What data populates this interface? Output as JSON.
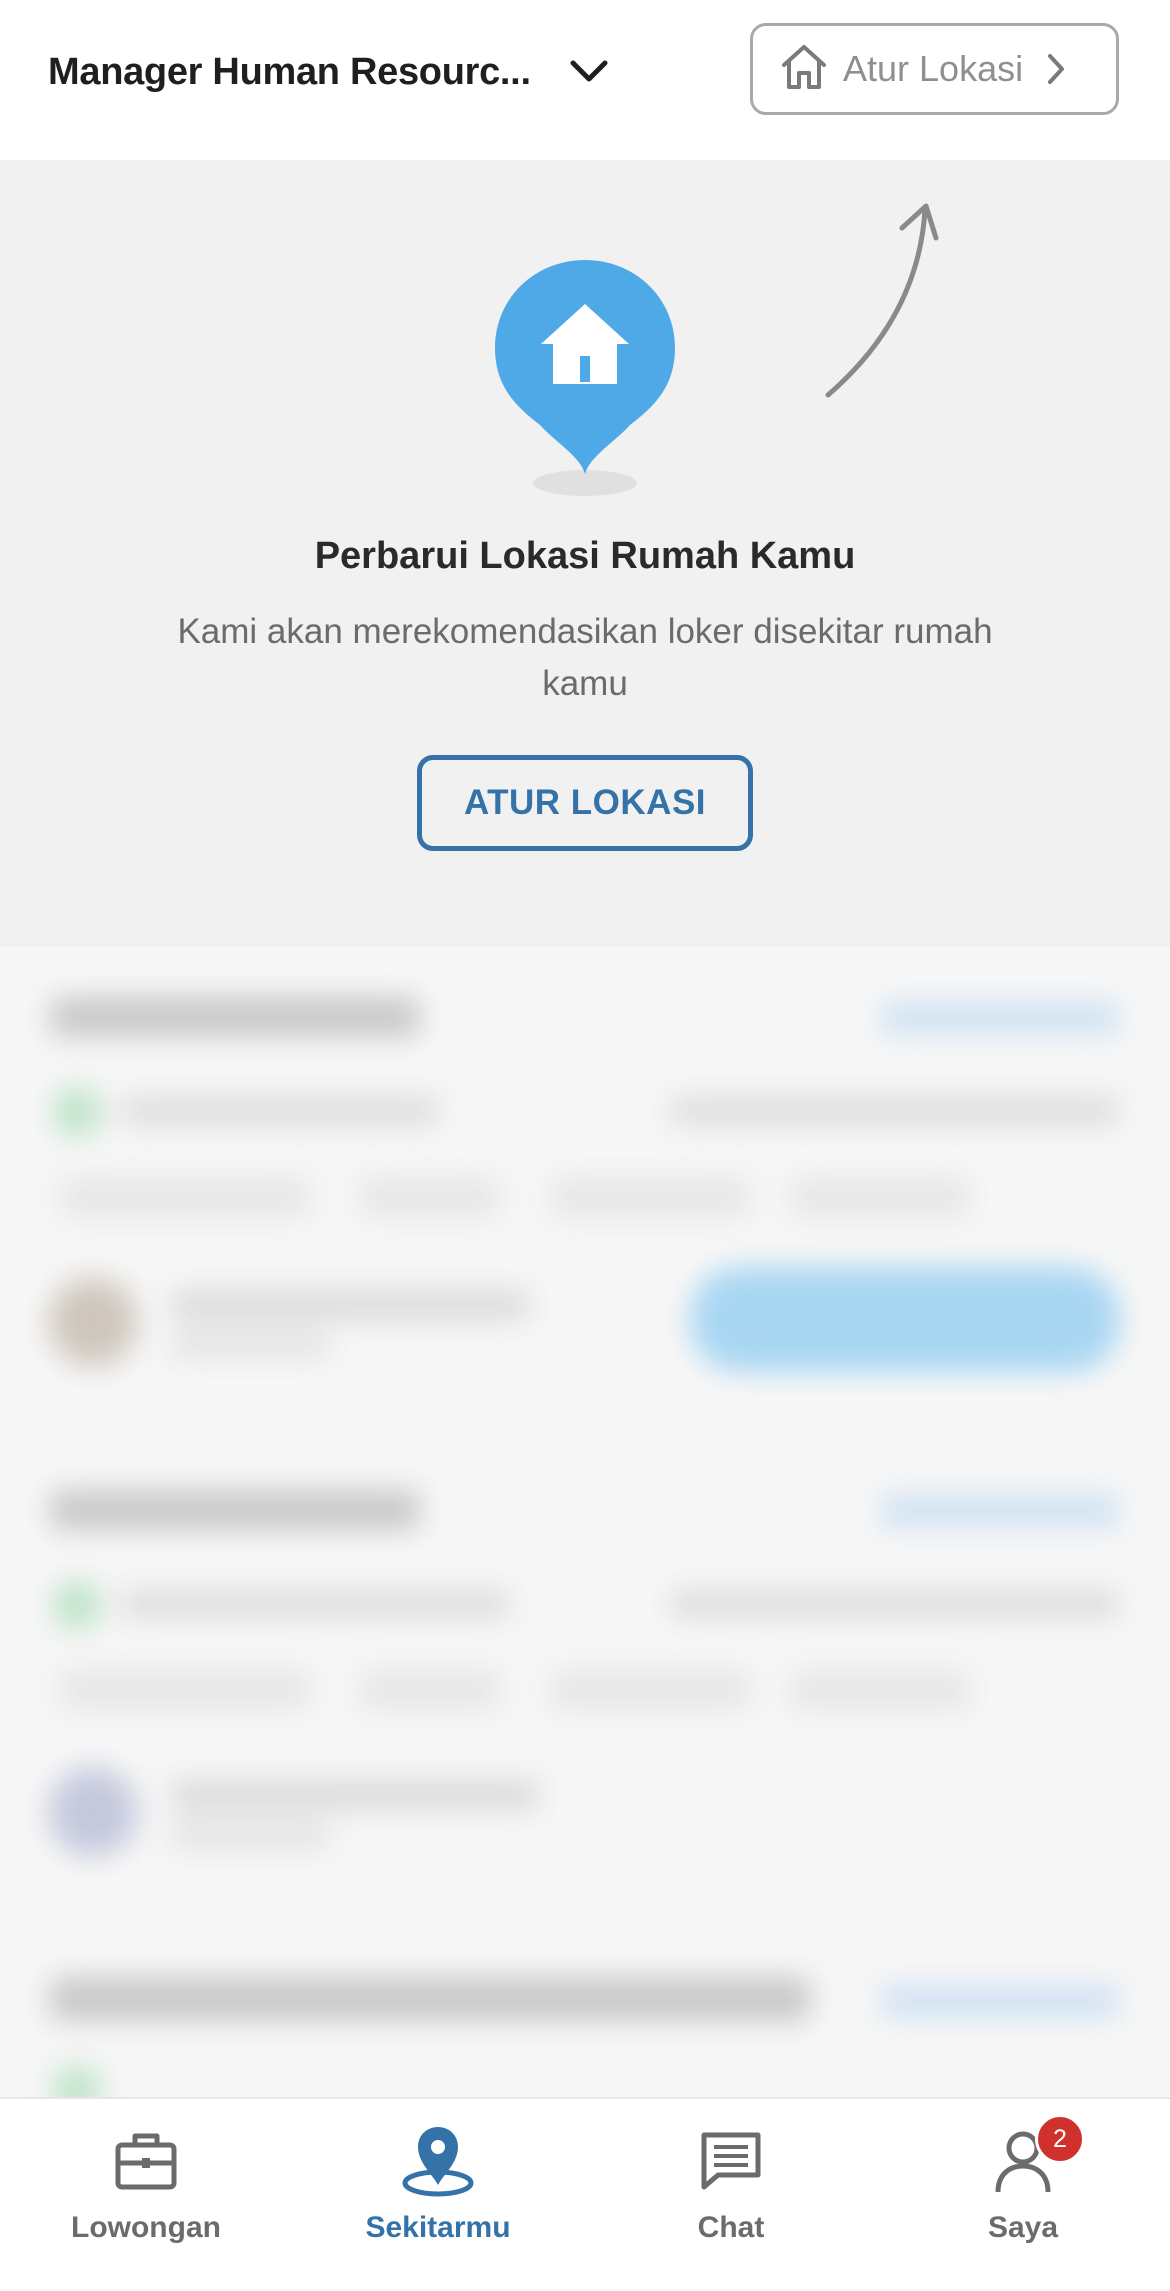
{
  "header": {
    "job_title": "Manager Human Resourc...",
    "location_button_label": "Atur Lokasi"
  },
  "banner": {
    "title": "Perbarui Lokasi Rumah Kamu",
    "description": "Kami akan merekomendasikan loker disekitar rumah kamu",
    "button_label": "ATUR LOKASI"
  },
  "bottom_nav": {
    "items": [
      {
        "label": "Lowongan",
        "icon": "briefcase-icon",
        "active": false
      },
      {
        "label": "Sekitarmu",
        "icon": "location-pin-icon",
        "active": true
      },
      {
        "label": "Chat",
        "icon": "chat-icon",
        "active": false
      },
      {
        "label": "Saya",
        "icon": "user-icon",
        "active": false,
        "badge": "2"
      }
    ]
  },
  "colors": {
    "accent": "#3472a8",
    "pin": "#4fa9e6",
    "badge": "#d0312d",
    "banner_bg": "#f1f1f1"
  }
}
